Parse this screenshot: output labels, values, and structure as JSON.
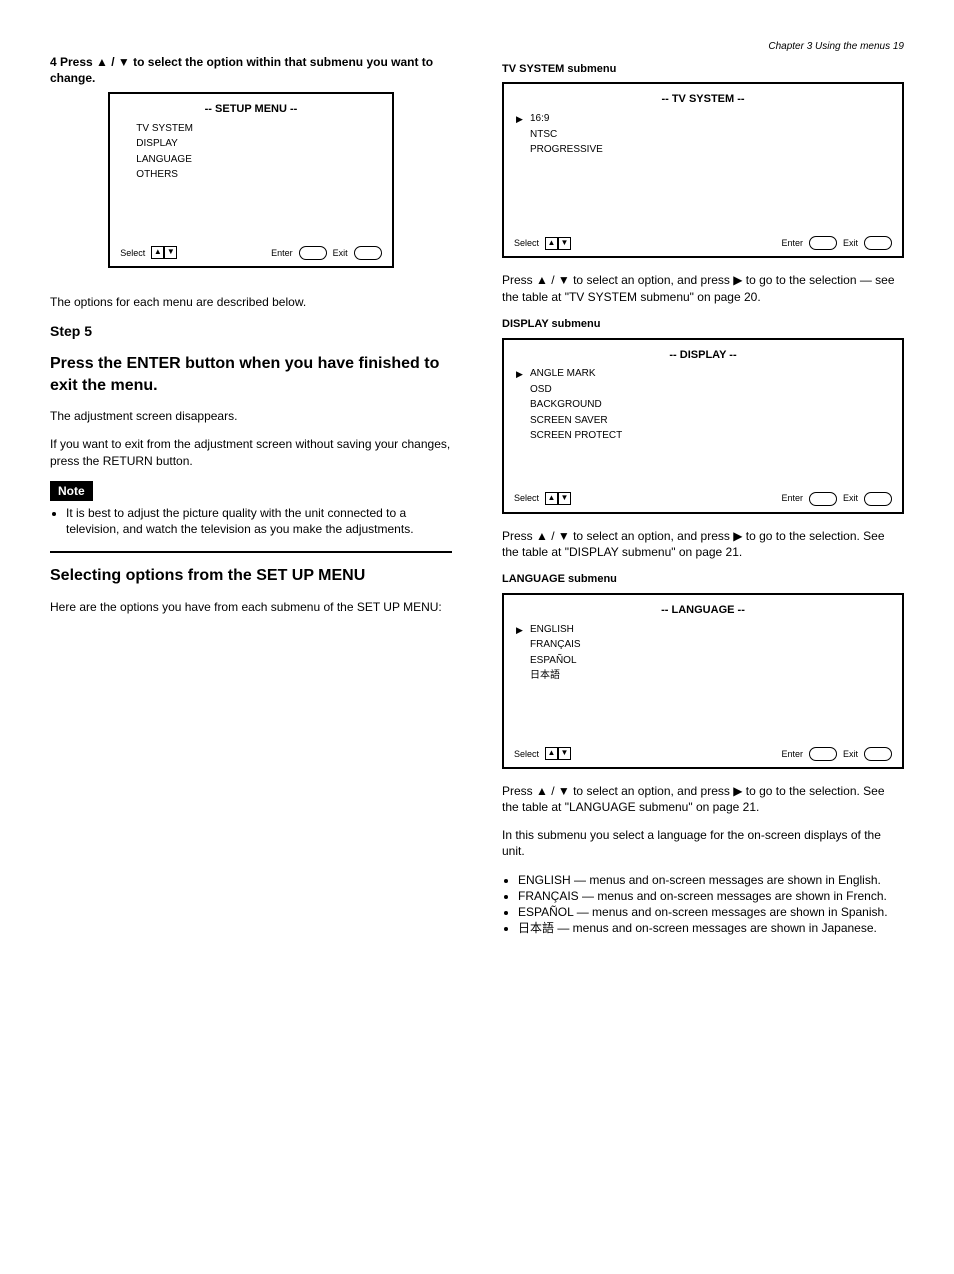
{
  "page_number": "19",
  "chapter_heading": "Chapter 3 Using the menus 19",
  "left": {
    "step4": "4  Press  ▲  /  ▼  to select the option within that submenu you want to change.",
    "box1": {
      "title": "TV SYSTEM",
      "items": [
        "DISPLAY",
        "LANGUAGE",
        "OTHERS"
      ],
      "fb1": "Select",
      "fb2": "Enter",
      "fb3": "Exit"
    },
    "after4": "The options for each menu are described below.",
    "step5_label": "Step 5",
    "step5_heading": "Press the ENTER button when you have finished to exit the menu.",
    "after5": "The adjustment screen disappears.",
    "after5b": "If you want to exit from the adjustment screen without saving your changes, press the RETURN button.",
    "note_label": "Note",
    "note_ul": "It is best to adjust the picture quality with the unit connected to a television, and watch the television as you make the adjustments.",
    "divider_heading": "Selecting options from the SET UP MENU",
    "divider_text": "Here are the options you have from each submenu of the SET UP MENU:"
  },
  "right": {
    "ts_title": "TV SYSTEM submenu",
    "box1": {
      "title": "TV SYSTEM",
      "items": [
        "16:9",
        "NTSC",
        "PROGRESSIVE"
      ],
      "fb1": "Select",
      "fb2": "Enter",
      "fb3": "Exit"
    },
    "ts_step": "Press  ▲  /  ▼  to select an option, and press  ▶  to go to the selection — see the table at \"TV SYSTEM submenu\" on page 20.",
    "disp_title": "DISPLAY submenu",
    "box2": {
      "title": "DISPLAY",
      "items": [
        "ANGLE MARK",
        "OSD",
        "BACKGROUND",
        "SCREEN SAVER",
        "SCREEN PROTECT"
      ],
      "fb1": "Select",
      "fb2": "Enter",
      "fb3": "Exit"
    },
    "disp_step": "Press  ▲  /  ▼  to select an option, and press  ▶  to go to the selection. See the table at \"DISPLAY submenu\" on page 21.",
    "lang_title": "LANGUAGE submenu",
    "box3": {
      "title": "LANGUAGE",
      "items": [
        "ENGLISH",
        "FRANÇAIS",
        "ESPAÑOL",
        "日本語"
      ],
      "fb1": "Select",
      "fb2": "Enter",
      "fb3": "Exit"
    },
    "lang_step": "Press  ▲  /  ▼  to select an option, and press  ▶  to go to the selection. See the table at \"LANGUAGE submenu\" on page 21.",
    "lang_para": "In this submenu you select a language for the on-screen displays of the unit.",
    "lang_bullets": [
      "ENGLISH — menus and on-screen messages are shown in English.",
      "FRANÇAIS — menus and on-screen messages are shown in French.",
      "ESPAÑOL — menus and on-screen messages are shown in Spanish.",
      "日本語 — menus and on-screen messages are shown in Japanese."
    ]
  }
}
